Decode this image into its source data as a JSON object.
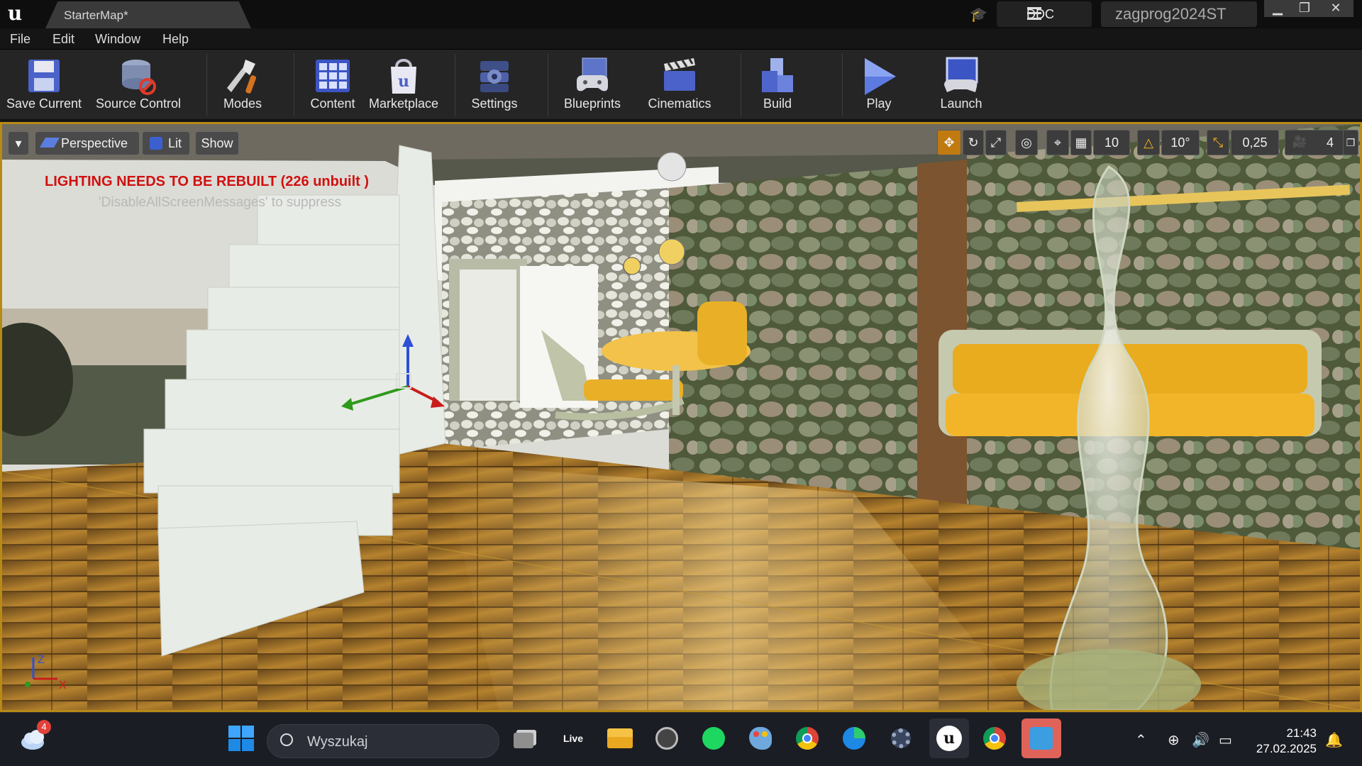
{
  "titlebar": {
    "tab_label": "StarterMap*",
    "ddc_label": "DDC",
    "project_name": "zagprog2024ST",
    "minimize": "▁",
    "restore": "❐",
    "close": "✕",
    "logo": "u"
  },
  "menu": [
    "File",
    "Edit",
    "Window",
    "Help"
  ],
  "toolbar": [
    {
      "label": "Save Current",
      "icon": "save-icon"
    },
    {
      "label": "Source Control",
      "icon": "source-control-icon"
    },
    {
      "label": "Modes",
      "icon": "modes-icon"
    },
    {
      "label": "Content",
      "icon": "content-icon"
    },
    {
      "label": "Marketplace",
      "icon": "marketplace-icon"
    },
    {
      "label": "Settings",
      "icon": "settings-icon"
    },
    {
      "label": "Blueprints",
      "icon": "blueprints-icon"
    },
    {
      "label": "Cinematics",
      "icon": "cinematics-icon"
    },
    {
      "label": "Build",
      "icon": "build-icon"
    },
    {
      "label": "Play",
      "icon": "play-icon"
    },
    {
      "label": "Launch",
      "icon": "launch-icon"
    }
  ],
  "viewport": {
    "perspective_label": "Perspective",
    "lit_label": "Lit",
    "show_label": "Show",
    "grid_snap": "10",
    "rotation_snap": "10°",
    "scale_snap": "0,25",
    "camera_speed": "4",
    "warning": "LIGHTING NEEDS TO BE REBUILT (226 unbuilt )",
    "warning_hint": "'DisableAllScreenMessages' to suppress",
    "axis": {
      "z": "Z",
      "x": "X"
    }
  },
  "taskbar": {
    "search_placeholder": "Wyszukaj",
    "weather_badge": "4",
    "live_label": "Live",
    "time": "21:43",
    "date": "27.02.2025",
    "colors": {
      "accent": "#0078d4",
      "ue_border": "#b78a16"
    }
  }
}
